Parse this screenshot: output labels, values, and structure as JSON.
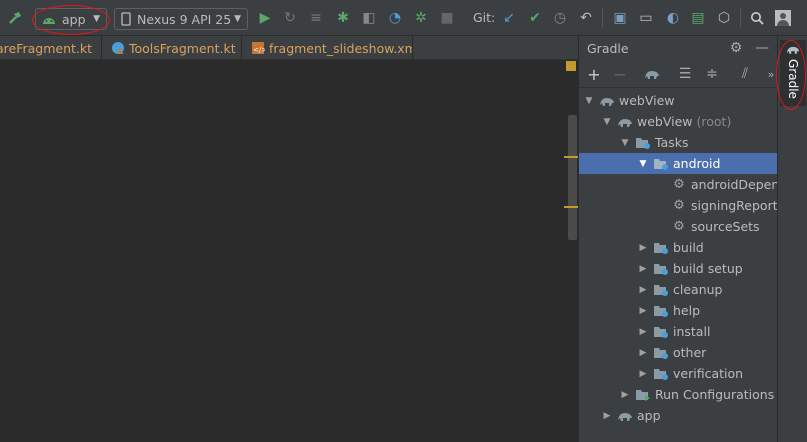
{
  "toolbar": {
    "run_config": "app",
    "device": "Nexus 9 API 25",
    "git_label": "Git:"
  },
  "tabs": [
    {
      "label": "areFragment.kt"
    },
    {
      "label": "ToolsFragment.kt"
    },
    {
      "label": "fragment_slideshow.xml"
    }
  ],
  "gradle": {
    "title": "Gradle",
    "side_tab_label": "Gradle",
    "tree": [
      {
        "label": "webView",
        "suffix": ""
      },
      {
        "label": "webView",
        "suffix": "(root)"
      },
      {
        "label": "Tasks",
        "suffix": ""
      },
      {
        "label": "android",
        "suffix": ""
      },
      {
        "label": "androidDependencies",
        "suffix": ""
      },
      {
        "label": "signingReport",
        "suffix": ""
      },
      {
        "label": "sourceSets",
        "suffix": ""
      },
      {
        "label": "build",
        "suffix": ""
      },
      {
        "label": "build setup",
        "suffix": ""
      },
      {
        "label": "cleanup",
        "suffix": ""
      },
      {
        "label": "help",
        "suffix": ""
      },
      {
        "label": "install",
        "suffix": ""
      },
      {
        "label": "other",
        "suffix": ""
      },
      {
        "label": "verification",
        "suffix": ""
      },
      {
        "label": "Run Configurations",
        "suffix": ""
      },
      {
        "label": "app",
        "suffix": ""
      }
    ]
  },
  "colors": {
    "accent_green": "#59a869",
    "selection_blue": "#4b6eaf",
    "tab_text_orange": "#d9a15d",
    "annotation_red": "#e01818"
  }
}
